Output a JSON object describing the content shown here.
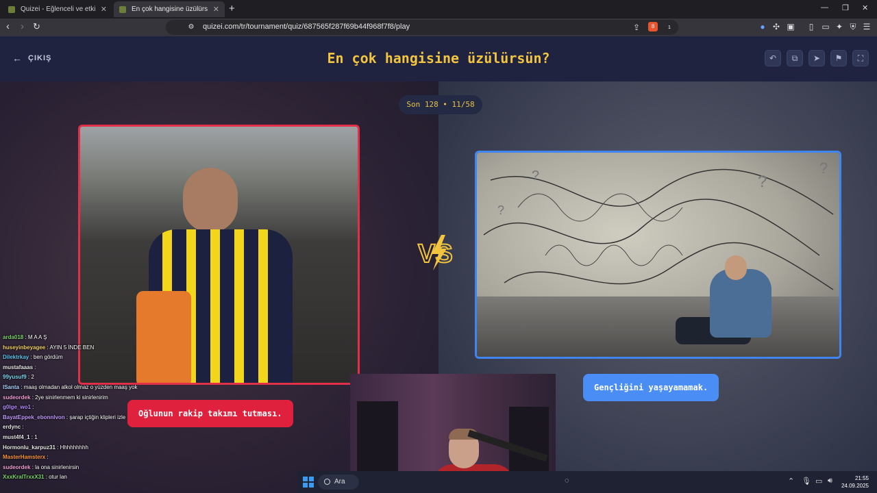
{
  "browser": {
    "tabs": [
      {
        "title": "Quizei - Eğlenceli ve etkileşimli quiz...",
        "active": false
      },
      {
        "title": "En çok hangisine üzülürsün? - Qu...",
        "active": true
      }
    ],
    "url": "quizei.com/tr/tournament/quiz/687565f287f69b44f968f7f8/play",
    "brave_badge": "8",
    "alert_badge": "1"
  },
  "page": {
    "exit_label": "ÇIKIŞ",
    "title": "En çok hangisine üzülürsün?",
    "round_label": "Son 128 • 11/58",
    "vs_label": "VS",
    "choices": [
      {
        "caption": "Oğlunun rakip takımı tutması.",
        "accent": "#e0213d"
      },
      {
        "caption": "Gençliğini yaşayamamak.",
        "accent": "#4a8ef5"
      }
    ]
  },
  "chat": [
    {
      "user": "arda018",
      "text": "M A A Ş",
      "color": "#7dd86b"
    },
    {
      "user": "huseyinbeyagee",
      "text": "AYIN 5 İNDE BEN",
      "color": "#f4d35e"
    },
    {
      "user": "Dilektrkay",
      "text": "ben gördüm",
      "color": "#5fc7f0"
    },
    {
      "user": "mustafaaas",
      "text": "",
      "color": "#e8e8e8"
    },
    {
      "user": "99yusuf9",
      "text": "2",
      "color": "#7ad7f0"
    },
    {
      "user": "lSanta",
      "text": "maaş olmadan alkol olmaz o yüzden maaş yok",
      "color": "#b0d7ff"
    },
    {
      "user": "sudeordek",
      "text": "2ye sinirlenmem ki sinirlenirim",
      "color": "#f4a0d8"
    },
    {
      "user": "g0lge_wo1",
      "text": "",
      "color": "#b68cff"
    },
    {
      "user": "BayatEppek_ebonnlvon",
      "text": "şarap içtiğin klipleri izle",
      "color": "#c39bff"
    },
    {
      "user": "erdync",
      "text": "",
      "color": "#e8e8e8"
    },
    {
      "user": "must4f4_1",
      "text": "1",
      "color": "#e8e8e8"
    },
    {
      "user": "Hormonlu_karpuz31",
      "text": "Hhhhhhhhh",
      "color": "#e8e8e8"
    },
    {
      "user": "MasterHamsterx",
      "text": "",
      "color": "#ff9a3c"
    },
    {
      "user": "sudeordek",
      "text": "la ona sinirlenirsin",
      "color": "#f4a0d8"
    },
    {
      "user": "XxxKralTrxxX31",
      "text": "otur lan",
      "color": "#7dd86b"
    }
  ],
  "taskbar": {
    "search_label": "Ara",
    "time": "21:55",
    "date": "24.09.2025"
  },
  "icons": {
    "back": "arrow-left-icon",
    "undo": "undo-icon",
    "copy": "copy-icon",
    "share": "send-icon",
    "report": "flag-icon",
    "fullscreen": "fullscreen-icon"
  }
}
